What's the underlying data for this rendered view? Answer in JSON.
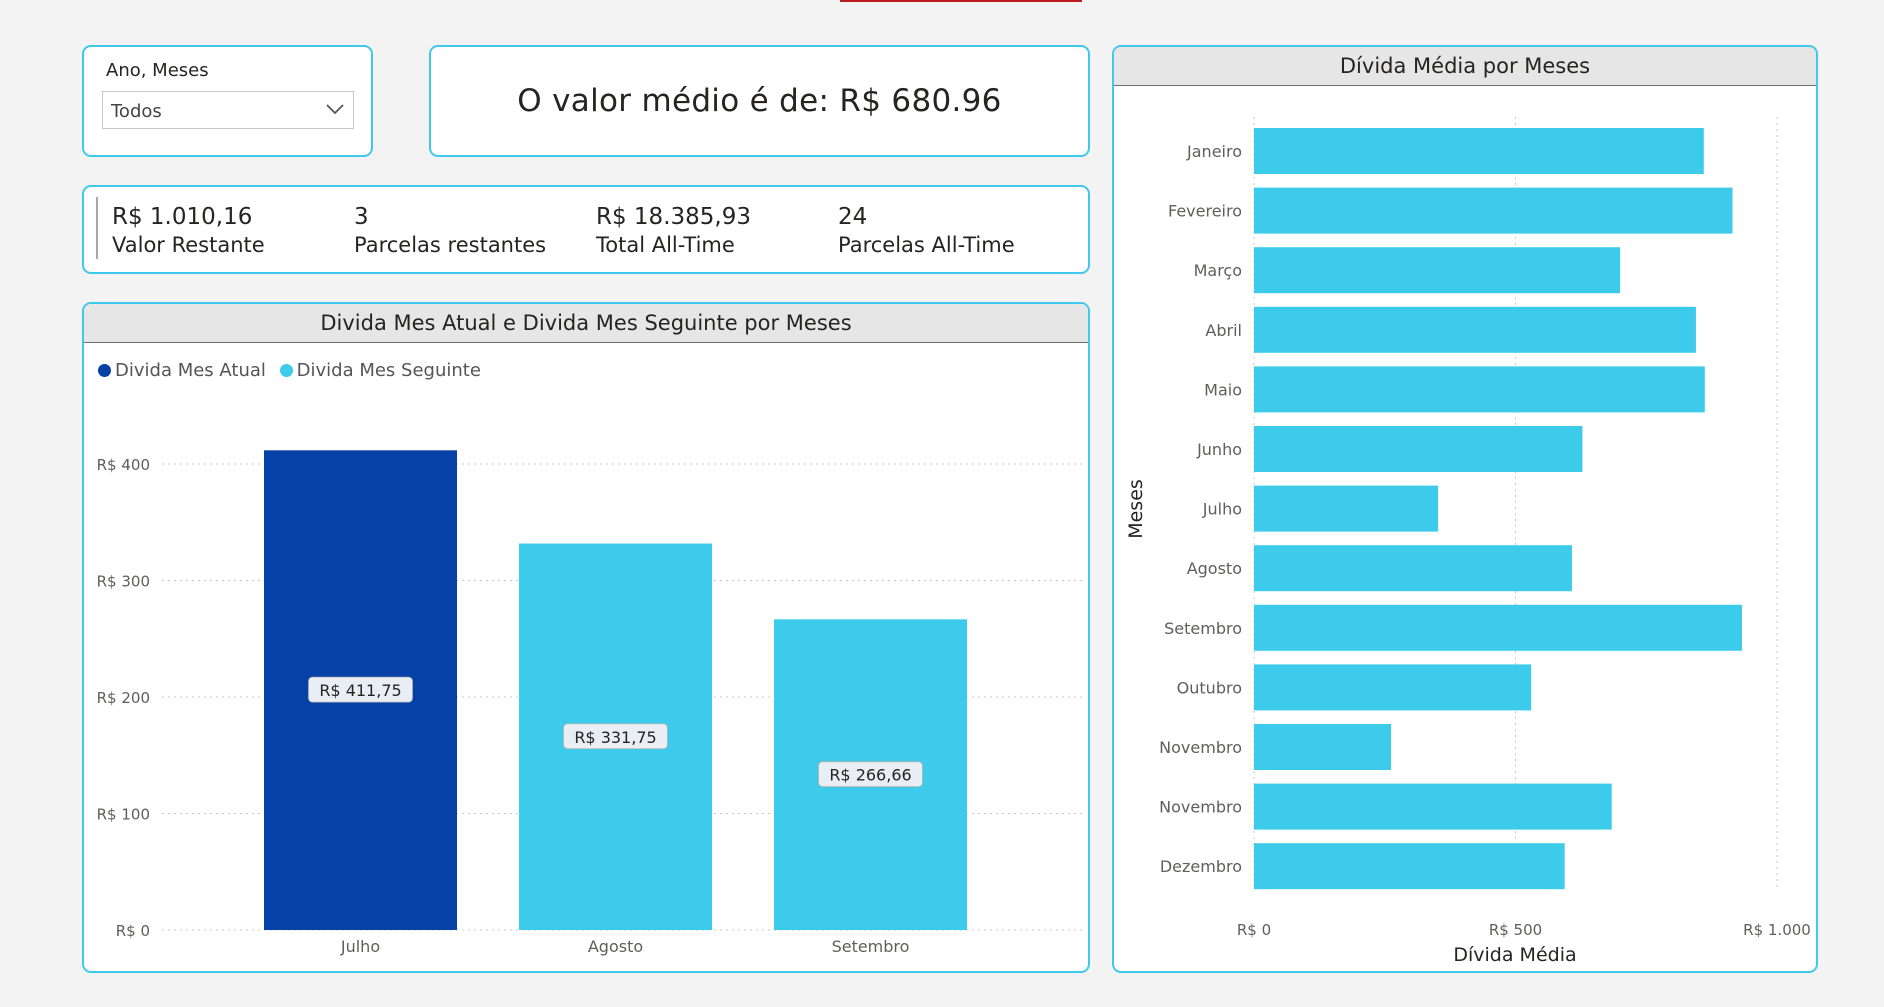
{
  "slicer": {
    "title": "Ano, Meses",
    "value": "Todos"
  },
  "kpi": {
    "text": "O valor médio é de: R$ 680.96"
  },
  "multi_card": {
    "items": [
      {
        "value": "R$ 1.010,16",
        "label": "Valor Restante"
      },
      {
        "value": "3",
        "label": "Parcelas restantes"
      },
      {
        "value": "R$ 18.385,93",
        "label": "Total All-Time"
      },
      {
        "value": "24",
        "label": "Parcelas All-Time"
      }
    ]
  },
  "colors": {
    "accent": "#3ec9eb",
    "dark": "#0641a8",
    "light": "#3dcbeb",
    "border": "#3ec9eb"
  },
  "chart_data": [
    {
      "type": "bar",
      "title": "Divida Mes Atual e Divida Mes Seguinte por Meses",
      "legend": [
        {
          "name": "Divida Mes Atual",
          "color": "#0641a8"
        },
        {
          "name": "Divida Mes Seguinte",
          "color": "#3dcbeb"
        }
      ],
      "legend_position": "top-left",
      "categories": [
        "Julho",
        "Agosto",
        "Setembro"
      ],
      "values": [
        411.75,
        331.75,
        266.66
      ],
      "data_labels": [
        "R$ 411,75",
        "R$ 331,75",
        "R$ 266,66"
      ],
      "series_of_bar": [
        "Divida Mes Atual",
        "Divida Mes Seguinte",
        "Divida Mes Seguinte"
      ],
      "ylim": [
        0,
        400
      ],
      "yticks": [
        0,
        100,
        200,
        300,
        400
      ],
      "ytick_labels": [
        "R$ 0",
        "R$ 100",
        "R$ 200",
        "R$ 300",
        "R$ 400"
      ],
      "grid": true
    },
    {
      "type": "bar",
      "orientation": "horizontal",
      "title": "Dívida Média por Meses",
      "ylabel": "Meses",
      "xlabel": "Dívida Média",
      "categories": [
        "Janeiro",
        "Fevereiro",
        "Março",
        "Abril",
        "Maio",
        "Junho",
        "Julho",
        "Agosto",
        "Setembro",
        "Outubro",
        "Novembro",
        "Novembro",
        "Dezembro"
      ],
      "values": [
        860,
        915,
        700,
        845,
        862,
        628,
        352,
        608,
        933,
        530,
        262,
        684,
        594
      ],
      "xlim": [
        0,
        1000
      ],
      "xticks": [
        0,
        500,
        1000
      ],
      "xtick_labels": [
        "R$ 0",
        "R$ 500",
        "R$ 1.000"
      ],
      "grid": true
    }
  ]
}
